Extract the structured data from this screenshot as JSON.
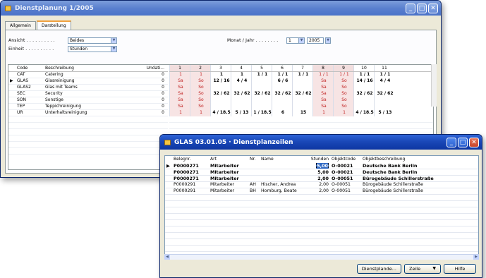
{
  "back": {
    "title": "Dienstplanung 1/2005",
    "tabs": [
      "Allgemein",
      "Darstellung"
    ],
    "ansicht_label": "Ansicht . . . . . . . . . .",
    "ansicht_value": "Beides",
    "einheit_label": "Einheit . . . . . . . . . .",
    "einheit_value": "Stunden",
    "monat_label": "Monat / Jahr . . . . . . . .",
    "monat_value": "1",
    "jahr_value": "2005",
    "headers": {
      "code": "Code",
      "desc": "Beschreibung",
      "undati": "Undati..."
    },
    "days": [
      "1",
      "2",
      "3",
      "4",
      "5",
      "6",
      "7",
      "8",
      "9",
      "10",
      "11"
    ],
    "rows": [
      {
        "sel": "",
        "code": "CAT",
        "desc": "Catering",
        "undati": "0",
        "cells": [
          "1",
          "1",
          "1",
          "1",
          "1 / 1",
          "1 / 1",
          "1 / 1",
          "1 / 1",
          "1 / 1",
          "1 / 1",
          "1 / 1"
        ]
      },
      {
        "sel": "▶",
        "code": "GLAS",
        "desc": "Glasreinigung",
        "undati": "0",
        "cells": [
          "Sa",
          "So",
          "12 / 16",
          "4 / 4",
          "",
          "6 / 6",
          "",
          "Sa",
          "So",
          "14 / 16",
          "4 / 4"
        ]
      },
      {
        "sel": "",
        "code": "GLAS2",
        "desc": "Glas mit Teams",
        "undati": "0",
        "cells": [
          "Sa",
          "So",
          "",
          "",
          "",
          "",
          "",
          "Sa",
          "So",
          "",
          ""
        ]
      },
      {
        "sel": "",
        "code": "SEC",
        "desc": "Security",
        "undati": "0",
        "cells": [
          "Sa",
          "So",
          "32 / 62",
          "32 / 62",
          "32 / 62",
          "32 / 62",
          "32 / 62",
          "Sa",
          "So",
          "32 / 62",
          "32 / 62"
        ]
      },
      {
        "sel": "",
        "code": "SON",
        "desc": "Sonstige",
        "undati": "0",
        "cells": [
          "Sa",
          "So",
          "",
          "",
          "",
          "",
          "",
          "Sa",
          "So",
          "",
          ""
        ]
      },
      {
        "sel": "",
        "code": "TEP",
        "desc": "Teppichreinigung",
        "undati": "0",
        "cells": [
          "Sa",
          "So",
          "",
          "",
          "",
          "",
          "",
          "Sa",
          "So",
          "",
          ""
        ]
      },
      {
        "sel": "",
        "code": "UR",
        "desc": "Unterhaltsreinigung",
        "undati": "0",
        "cells": [
          "1",
          "1",
          "4 / 18.5",
          "5 / 13",
          "1 / 18.5",
          "6",
          "15",
          "1",
          "1",
          "4 / 18.5",
          "5 / 13"
        ]
      }
    ]
  },
  "front": {
    "title": "GLAS 03.01.05 · Dienstplanzeilen",
    "headers": {
      "bel": "Belegnr.",
      "art": "Art",
      "nr": "Nr.",
      "name": "Name",
      "std": "Stunden",
      "obj": "Objektcode",
      "objd": "Objektbeschreibung"
    },
    "rows": [
      {
        "sel": "▶",
        "bel": "P0000271",
        "art": "Mitarbeiter",
        "nr": "",
        "name": "",
        "std": "5,00",
        "obj": "O-00021",
        "objd": "Deutsche Bank Berlin",
        "bold": true
      },
      {
        "sel": "",
        "bel": "P0000271",
        "art": "Mitarbeiter",
        "nr": "",
        "name": "",
        "std": "5,00",
        "obj": "O-00021",
        "objd": "Deutsche Bank Berlin",
        "bold": true
      },
      {
        "sel": "",
        "bel": "P0000271",
        "art": "Mitarbeiter",
        "nr": "",
        "name": "",
        "std": "2,00",
        "obj": "O-00051",
        "objd": "Bürogebäude Schillerstraße",
        "bold": true
      },
      {
        "sel": "",
        "bel": "P0000291",
        "art": "Mitarbeiter",
        "nr": "AH",
        "name": "Hischer, Andrea",
        "std": "2,00",
        "obj": "O-00051",
        "objd": "Bürogebäude Schillerstraße",
        "bold": false
      },
      {
        "sel": "",
        "bel": "P0000291",
        "art": "Mitarbeiter",
        "nr": "BH",
        "name": "Homburg, Beate",
        "std": "2,00",
        "obj": "O-00051",
        "objd": "Bürogebäude Schillerstraße",
        "bold": false
      }
    ],
    "buttons": {
      "dienstplan": "Dienstplande...",
      "zeile": "Zeile",
      "hilfe": "Hilfe"
    }
  },
  "colors": {
    "titlebar_active": "#1a48b8",
    "weekend_text": "#c02020",
    "selection": "#316ac5"
  }
}
